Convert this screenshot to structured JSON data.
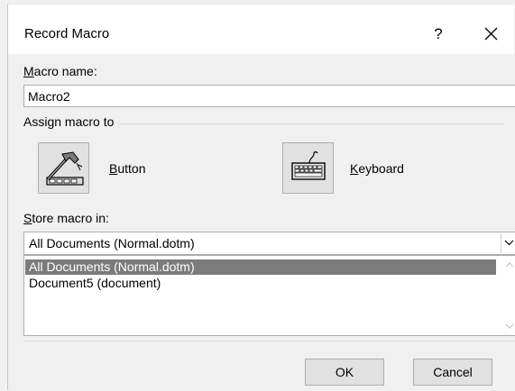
{
  "dialog": {
    "title": "Record Macro",
    "help_label": "?"
  },
  "macro_name": {
    "label_accel": "M",
    "label_rest": "acro name:",
    "value": "Macro2"
  },
  "assign": {
    "group_label": "Assign macro to",
    "button_accel": "B",
    "button_rest": "utton",
    "keyboard_accel": "K",
    "keyboard_rest": "eyboard"
  },
  "store": {
    "label_accel": "S",
    "label_rest": "tore macro in:",
    "selected": "All Documents (Normal.dotm)",
    "options": [
      "All Documents (Normal.dotm)",
      "Document5 (document)"
    ]
  },
  "buttons": {
    "ok": "OK",
    "cancel": "Cancel"
  },
  "icons": {
    "help": "help-icon",
    "close": "close-icon",
    "button": "hammer-toolbar-icon",
    "keyboard": "keyboard-icon",
    "dropdown": "chevron-down-icon"
  }
}
